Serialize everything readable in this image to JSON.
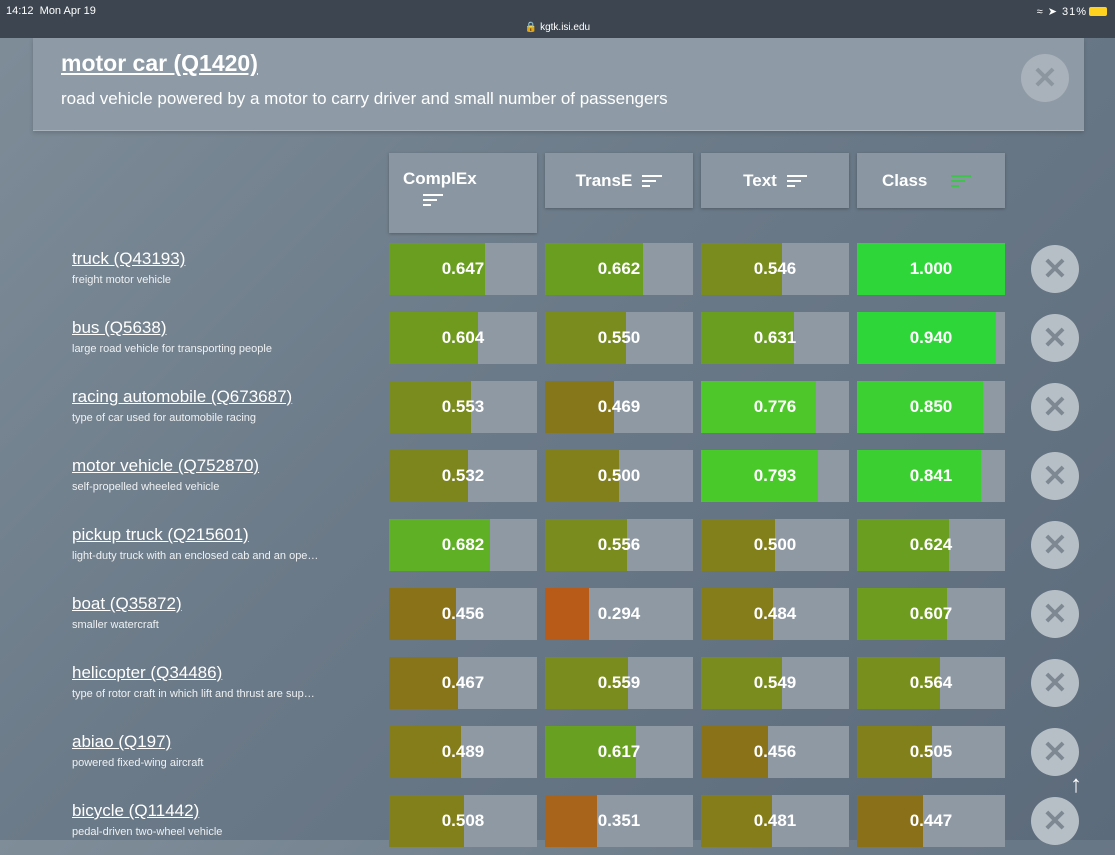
{
  "status_bar": {
    "time": "14:12",
    "date": "Mon Apr 19",
    "url": "kgtk.isi.edu",
    "battery": "31%"
  },
  "header": {
    "title": "motor car (Q1420)",
    "description": "road vehicle powered by a motor to carry driver and small number of passengers"
  },
  "columns": [
    {
      "label": "ComplEx",
      "sort_active": false
    },
    {
      "label": "TransE",
      "sort_active": false
    },
    {
      "label": "Text",
      "sort_active": false
    },
    {
      "label": "Class",
      "sort_active": true
    }
  ],
  "rows": [
    {
      "title": "truck (Q43193)",
      "description": "freight motor vehicle",
      "scores": [
        "0.647",
        "0.662",
        "0.546",
        "1.000"
      ],
      "fractions": [
        0.647,
        0.662,
        0.546,
        1.0
      ],
      "colors": [
        "#6a9e20",
        "#6a9e20",
        "#7a8c1d",
        "#2fd63a"
      ]
    },
    {
      "title": "bus (Q5638)",
      "description": "large road vehicle for transporting people",
      "scores": [
        "0.604",
        "0.550",
        "0.631",
        "0.940"
      ],
      "fractions": [
        0.604,
        0.55,
        0.631,
        0.94
      ],
      "colors": [
        "#709a1e",
        "#7a8c1d",
        "#6a9e20",
        "#2fd63a"
      ]
    },
    {
      "title": "racing automobile (Q673687)",
      "description": "type of car used for automobile racing",
      "scores": [
        "0.553",
        "0.469",
        "0.776",
        "0.850"
      ],
      "fractions": [
        0.553,
        0.469,
        0.776,
        0.85
      ],
      "colors": [
        "#7a8c1d",
        "#86781a",
        "#4dc72a",
        "#3cd032"
      ]
    },
    {
      "title": "motor vehicle (Q752870)",
      "description": "self-propelled wheeled vehicle",
      "scores": [
        "0.532",
        "0.500",
        "0.793",
        "0.841"
      ],
      "fractions": [
        0.532,
        0.5,
        0.793,
        0.841
      ],
      "colors": [
        "#7d861c",
        "#82801b",
        "#4ac92b",
        "#3ccf32"
      ]
    },
    {
      "title": "pickup truck (Q215601)",
      "description": "light-duty truck with an enclosed cab and an ope…",
      "scores": [
        "0.682",
        "0.556",
        "0.500",
        "0.624"
      ],
      "fractions": [
        0.682,
        0.556,
        0.5,
        0.624
      ],
      "colors": [
        "#5fb024",
        "#7a8c1d",
        "#82801b",
        "#6a9e20"
      ]
    },
    {
      "title": "boat (Q35872)",
      "description": "smaller watercraft",
      "scores": [
        "0.456",
        "0.294",
        "0.484",
        "0.607"
      ],
      "fractions": [
        0.456,
        0.294,
        0.484,
        0.607
      ],
      "colors": [
        "#8a7219",
        "#b85a18",
        "#857c1a",
        "#6e9c1f"
      ]
    },
    {
      "title": "helicopter (Q34486)",
      "description": "type of rotor craft in which lift and thrust are sup…",
      "scores": [
        "0.467",
        "0.559",
        "0.549",
        "0.564"
      ],
      "fractions": [
        0.467,
        0.559,
        0.549,
        0.564
      ],
      "colors": [
        "#88751a",
        "#7a8c1d",
        "#7a8c1d",
        "#788f1e"
      ]
    },
    {
      "title": "abiao (Q197)",
      "description": "powered fixed-wing aircraft",
      "scores": [
        "0.489",
        "0.617",
        "0.456",
        "0.505"
      ],
      "fractions": [
        0.489,
        0.617,
        0.456,
        0.505
      ],
      "colors": [
        "#857c1a",
        "#68a021",
        "#8a7219",
        "#82801b"
      ]
    },
    {
      "title": "bicycle (Q11442)",
      "description": "pedal-driven two-wheel vehicle",
      "scores": [
        "0.508",
        "0.351",
        "0.481",
        "0.447"
      ],
      "fractions": [
        0.508,
        0.351,
        0.481,
        0.447
      ],
      "colors": [
        "#82801b",
        "#a8641a",
        "#857c1a",
        "#8b701a"
      ]
    }
  ]
}
